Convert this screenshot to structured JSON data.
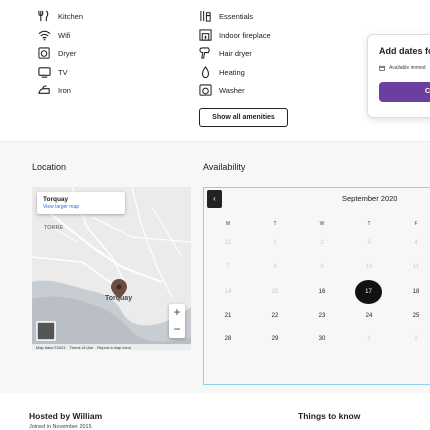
{
  "amenities": {
    "left": [
      {
        "label": "Kitchen",
        "icon": "kitchen-icon"
      },
      {
        "label": "Wifi",
        "icon": "wifi-icon"
      },
      {
        "label": "Dryer",
        "icon": "dryer-icon"
      },
      {
        "label": "TV",
        "icon": "tv-icon"
      },
      {
        "label": "Iron",
        "icon": "iron-icon"
      }
    ],
    "right": [
      {
        "label": "Essentials",
        "icon": "essentials-icon"
      },
      {
        "label": "Indoor fireplace",
        "icon": "fireplace-icon"
      },
      {
        "label": "Hair dryer",
        "icon": "hair-dryer-icon"
      },
      {
        "label": "Heating",
        "icon": "heating-icon"
      },
      {
        "label": "Washer",
        "icon": "washer-icon"
      }
    ],
    "show_all_label": "Show all amenities"
  },
  "booking": {
    "title": "Add dates fo",
    "availability_text": "Available immed",
    "button_label": "Cl"
  },
  "location": {
    "title": "Location",
    "map_place": "Torquay",
    "map_link": "View larger map",
    "labels": {
      "torre": "TORRE",
      "torquay": "Torquay"
    },
    "zoom_in": "+",
    "zoom_out": "−",
    "footer": [
      "Map data ©2021",
      "Terms of Use",
      "Report a map error"
    ]
  },
  "availability": {
    "title": "Availability",
    "month": "September 2020",
    "prev_label": "‹",
    "weekdays": [
      "M",
      "T",
      "W",
      "T",
      "F"
    ],
    "weeks": [
      [
        {
          "d": "31",
          "dim": true
        },
        {
          "d": "1",
          "dim": true
        },
        {
          "d": "2",
          "dim": true
        },
        {
          "d": "3",
          "dim": true
        },
        {
          "d": "4",
          "dim": true
        }
      ],
      [
        {
          "d": "7",
          "dim": true
        },
        {
          "d": "8",
          "dim": true
        },
        {
          "d": "9",
          "dim": true
        },
        {
          "d": "10",
          "dim": true
        },
        {
          "d": "11",
          "dim": true
        }
      ],
      [
        {
          "d": "14",
          "dim": true
        },
        {
          "d": "15",
          "dim": true
        },
        {
          "d": "16",
          "dim": false
        },
        {
          "d": "17",
          "dim": false,
          "selected": true
        },
        {
          "d": "18",
          "dim": false
        }
      ],
      [
        {
          "d": "21",
          "dim": false
        },
        {
          "d": "22",
          "dim": false
        },
        {
          "d": "23",
          "dim": false
        },
        {
          "d": "24",
          "dim": false
        },
        {
          "d": "25",
          "dim": false
        }
      ],
      [
        {
          "d": "28",
          "dim": false
        },
        {
          "d": "29",
          "dim": false
        },
        {
          "d": "30",
          "dim": false
        },
        {
          "d": "1",
          "dim": true
        },
        {
          "d": "2",
          "dim": true
        }
      ]
    ]
  },
  "host": {
    "title": "Hosted by William",
    "joined": "Joined in November 2015"
  },
  "things_to_know": {
    "title": "Things to know"
  },
  "colors": {
    "accent": "#6b3fa0",
    "selected": "#111111",
    "calendar_border": "#8fd0ea",
    "section_bg": "#f7f7f7"
  }
}
